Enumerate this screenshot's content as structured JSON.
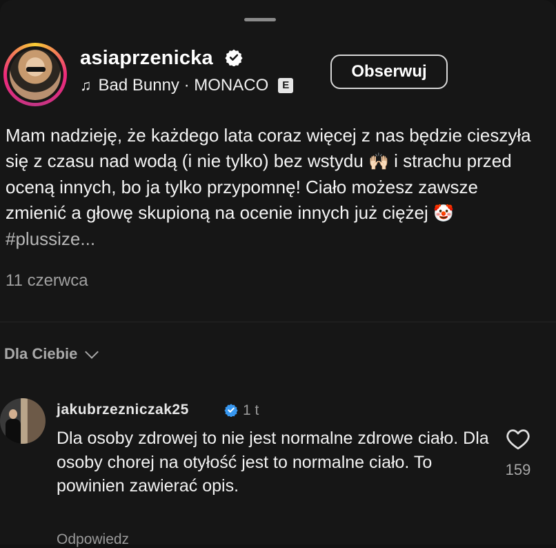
{
  "post": {
    "username": "asiaprzenicka",
    "music": "Bad Bunny · MONACO",
    "explicit_badge": "E",
    "follow_label": "Obserwuj",
    "caption": {
      "part1": "Mam nadzieję, że każdego lata coraz więcej z nas będzie cieszyła się z czasu nad wodą (i nie tylko) bez wstydu ",
      "emoji1": "🙌🏻",
      "part2": " i strachu przed oceną innych, bo ja tylko przypomnę! Ciało możesz zawsze zmienić a głowę skupioną na ocenie innych już ciężej ",
      "emoji2": "🤡",
      "hashtag": " #plussize..."
    },
    "date": "11 czerwca"
  },
  "comments_section": {
    "toggle_label": "Dla Ciebie",
    "comments": [
      {
        "username": "jakubrzezniczak25",
        "time": "1 t",
        "text": "Dla osoby zdrowej to nie jest normalne zdrowe ciało. Dla osoby chorej na otyłość jest to normalne ciało. To powinien zawierać opis.",
        "likes": "159",
        "reply_label": "Odpowiedz"
      }
    ]
  },
  "icons": {
    "verified": "verified-badge-icon",
    "music": "music-note-icon",
    "like": "heart-icon",
    "toggle": "chevron-down-icon"
  },
  "colors": {
    "background": "#161616",
    "verified_badge": "#3797f0",
    "story_ring": "#ee2a7b"
  }
}
